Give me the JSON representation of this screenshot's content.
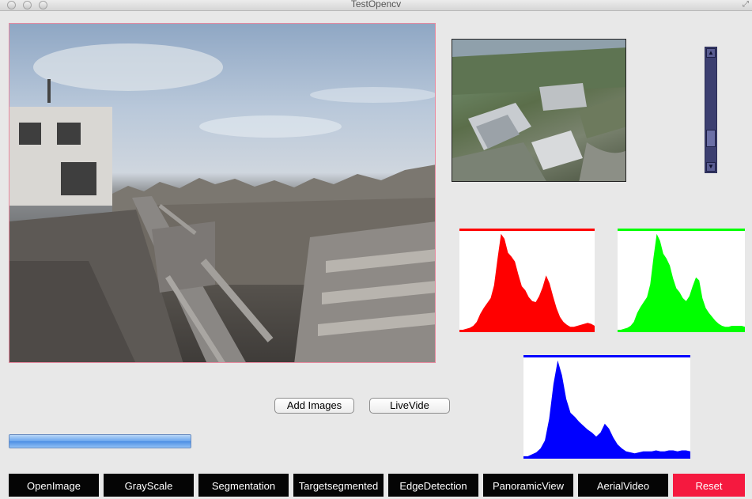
{
  "window": {
    "title": "TestOpencv"
  },
  "main_image": {
    "description_icon": "photo"
  },
  "thumbnail": {
    "description_icon": "photo"
  },
  "scrollbar": {
    "value": 0.8
  },
  "buttons": {
    "add_images": "Add Images",
    "live_video": "LiveVide"
  },
  "progress": {
    "value": 1.0
  },
  "toolbar": [
    {
      "label": "OpenImage"
    },
    {
      "label": "GrayScale"
    },
    {
      "label": "Segmentation"
    },
    {
      "label": "Targetsegmented"
    },
    {
      "label": "EdgeDetection"
    },
    {
      "label": "PanoramicView"
    },
    {
      "label": "AerialVideo"
    },
    {
      "label": "Reset"
    }
  ],
  "colors": {
    "red": "#ff0000",
    "green": "#00ff00",
    "blue": "#0000ff",
    "reset": "#f5193f",
    "toolbar": "#050505"
  },
  "histograms": {
    "red": [
      0.0,
      0.0,
      0.01,
      0.02,
      0.04,
      0.08,
      0.16,
      0.22,
      0.27,
      0.32,
      0.45,
      0.72,
      0.97,
      0.92,
      0.78,
      0.74,
      0.69,
      0.56,
      0.44,
      0.4,
      0.33,
      0.29,
      0.28,
      0.34,
      0.43,
      0.55,
      0.47,
      0.34,
      0.22,
      0.13,
      0.08,
      0.05,
      0.03,
      0.03,
      0.04,
      0.05,
      0.06,
      0.07,
      0.06,
      0.04
    ],
    "green": [
      0.0,
      0.0,
      0.01,
      0.02,
      0.04,
      0.08,
      0.17,
      0.23,
      0.28,
      0.33,
      0.46,
      0.73,
      0.97,
      0.9,
      0.77,
      0.72,
      0.65,
      0.52,
      0.42,
      0.38,
      0.32,
      0.29,
      0.34,
      0.44,
      0.53,
      0.5,
      0.32,
      0.22,
      0.17,
      0.13,
      0.09,
      0.06,
      0.04,
      0.03,
      0.03,
      0.04,
      0.04,
      0.04,
      0.04,
      0.03
    ],
    "blue": [
      0.0,
      0.0,
      0.02,
      0.04,
      0.08,
      0.16,
      0.38,
      0.73,
      0.97,
      0.82,
      0.58,
      0.44,
      0.4,
      0.35,
      0.31,
      0.27,
      0.24,
      0.2,
      0.24,
      0.33,
      0.28,
      0.19,
      0.12,
      0.08,
      0.05,
      0.04,
      0.03,
      0.04,
      0.05,
      0.05,
      0.05,
      0.06,
      0.05,
      0.05,
      0.06,
      0.06,
      0.05,
      0.06,
      0.06,
      0.05
    ]
  }
}
